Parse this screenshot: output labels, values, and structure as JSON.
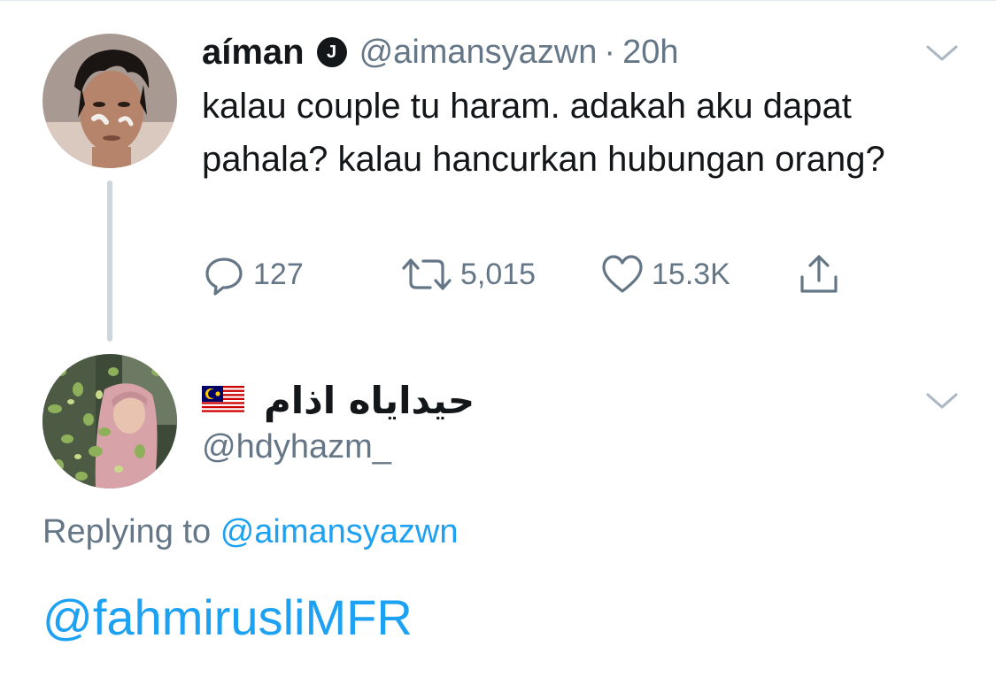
{
  "original_tweet": {
    "display_name": "aíman",
    "verified_letter": "J",
    "handle": "@aimansyazwn",
    "separator": "·",
    "time": "20h",
    "text": "kalau couple tu haram. adakah aku dapat pahala? kalau hancurkan hubungan orang?",
    "actions": {
      "reply_count": "127",
      "retweet_count": "5,015",
      "like_count": "15.3K"
    }
  },
  "reply_tweet": {
    "display_name": "حيداياه اذام",
    "flag_icon": "malaysia-flag-icon",
    "handle": "@hdyhazm_",
    "replying_label": "Replying to",
    "replying_to": "@aimansyazwn",
    "text": "@fahmirusliMFR"
  },
  "colors": {
    "link": "#1da1f2",
    "muted": "#657786",
    "text": "#14171a",
    "thread_line": "#ccd6dd"
  }
}
